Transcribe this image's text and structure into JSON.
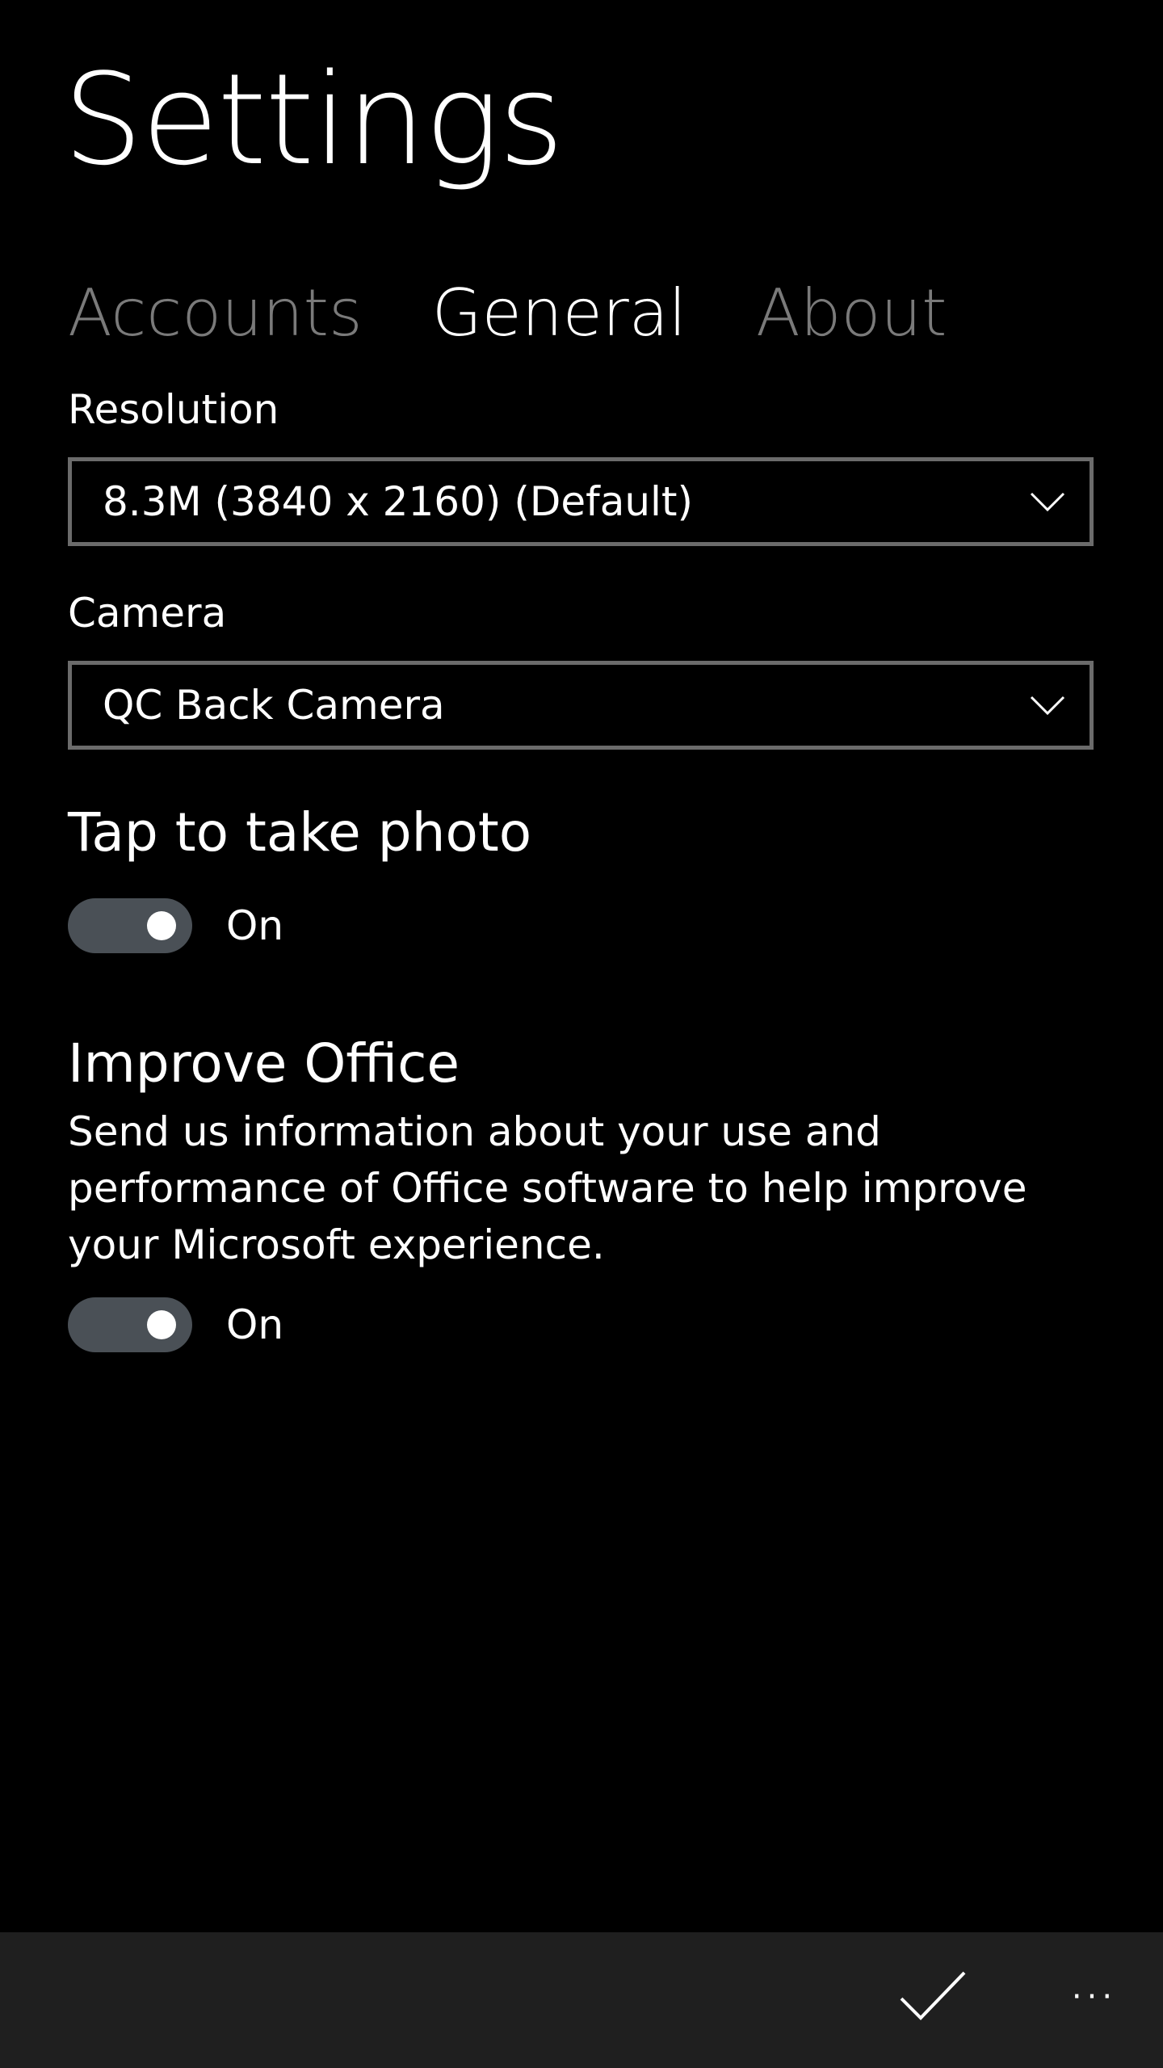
{
  "page": {
    "title": "Settings"
  },
  "pivot": {
    "tabs": [
      {
        "label": "Accounts",
        "active": false
      },
      {
        "label": "General",
        "active": true
      },
      {
        "label": "About",
        "active": false
      }
    ]
  },
  "resolution": {
    "label": "Resolution",
    "value": "8.3M (3840 x 2160) (Default)",
    "icon": "chevron-down-icon"
  },
  "camera": {
    "label": "Camera",
    "value": "QC Back Camera",
    "icon": "chevron-down-icon"
  },
  "tap_to_take_photo": {
    "header": "Tap to take photo",
    "toggle_state": "On",
    "enabled": true
  },
  "improve_office": {
    "header": "Improve Office",
    "description": "Send us information about your use and performance of Office software to help improve your Microsoft experience.",
    "toggle_state": "On",
    "enabled": true
  },
  "app_bar": {
    "confirm_icon": "checkmark-icon",
    "more_icon": "more-icon",
    "more_glyph": "···"
  },
  "colors": {
    "background": "#000000",
    "app_bar": "#1f1f1f",
    "inactive_tab": "#7a7a7a",
    "toggle_track": "#4a5056"
  }
}
